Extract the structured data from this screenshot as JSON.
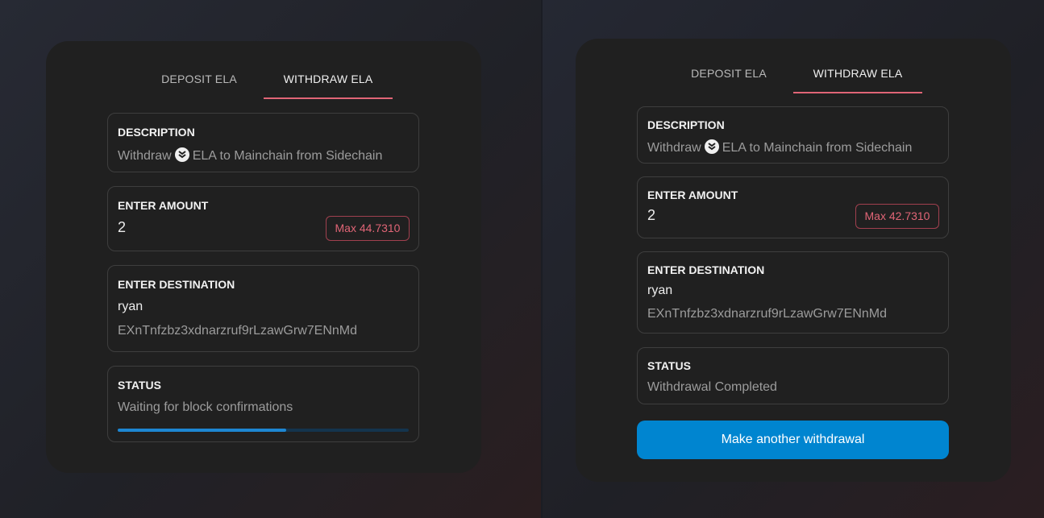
{
  "left": {
    "tabs": {
      "deposit": "DEPOSIT ELA",
      "withdraw": "WITHDRAW ELA"
    },
    "description": {
      "label": "DESCRIPTION",
      "text_before": "Withdraw",
      "text_after": "ELA to Mainchain from Sidechain",
      "icon": "ela-icon"
    },
    "amount": {
      "label": "ENTER AMOUNT",
      "value": "2",
      "max_label": "Max 44.7310"
    },
    "destination": {
      "label": "ENTER DESTINATION",
      "name": "ryan",
      "address": "EXnTnfzbz3xdnarzruf9rLzawGrw7ENnMd"
    },
    "status": {
      "label": "STATUS",
      "text": "Waiting for block confirmations",
      "progress": 0.58
    }
  },
  "right": {
    "tabs": {
      "deposit": "DEPOSIT ELA",
      "withdraw": "WITHDRAW ELA"
    },
    "description": {
      "label": "DESCRIPTION",
      "text_before": "Withdraw",
      "text_after": "ELA to Mainchain from Sidechain",
      "icon": "ela-icon"
    },
    "amount": {
      "label": "ENTER AMOUNT",
      "value": "2",
      "max_label": "Max 42.7310"
    },
    "destination": {
      "label": "ENTER DESTINATION",
      "name": "ryan",
      "address": "EXnTnfzbz3xdnarzruf9rLzawGrw7ENnMd"
    },
    "status": {
      "label": "STATUS",
      "text": "Withdrawal Completed"
    },
    "action_button": "Make another withdrawal"
  },
  "colors": {
    "accent": "#e06576",
    "primary": "#0085d0",
    "card_bg": "#202020"
  }
}
